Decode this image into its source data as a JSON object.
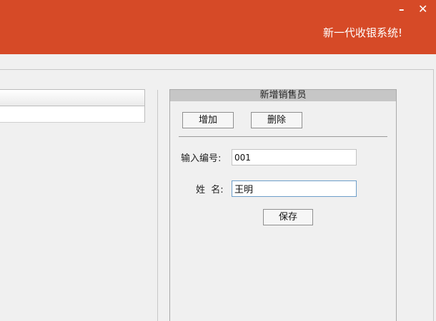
{
  "window": {
    "title": "新一代收银系统!",
    "minimize_glyph": "–",
    "close_glyph": "✕"
  },
  "panel": {
    "title": "新增销售员",
    "add_label": "增加",
    "delete_label": "删除",
    "code_label": "输入编号:",
    "code_value": "001",
    "name_label": "姓  名:",
    "name_value": "王明",
    "save_label": "保存"
  },
  "colors": {
    "accent": "#d64a27"
  }
}
